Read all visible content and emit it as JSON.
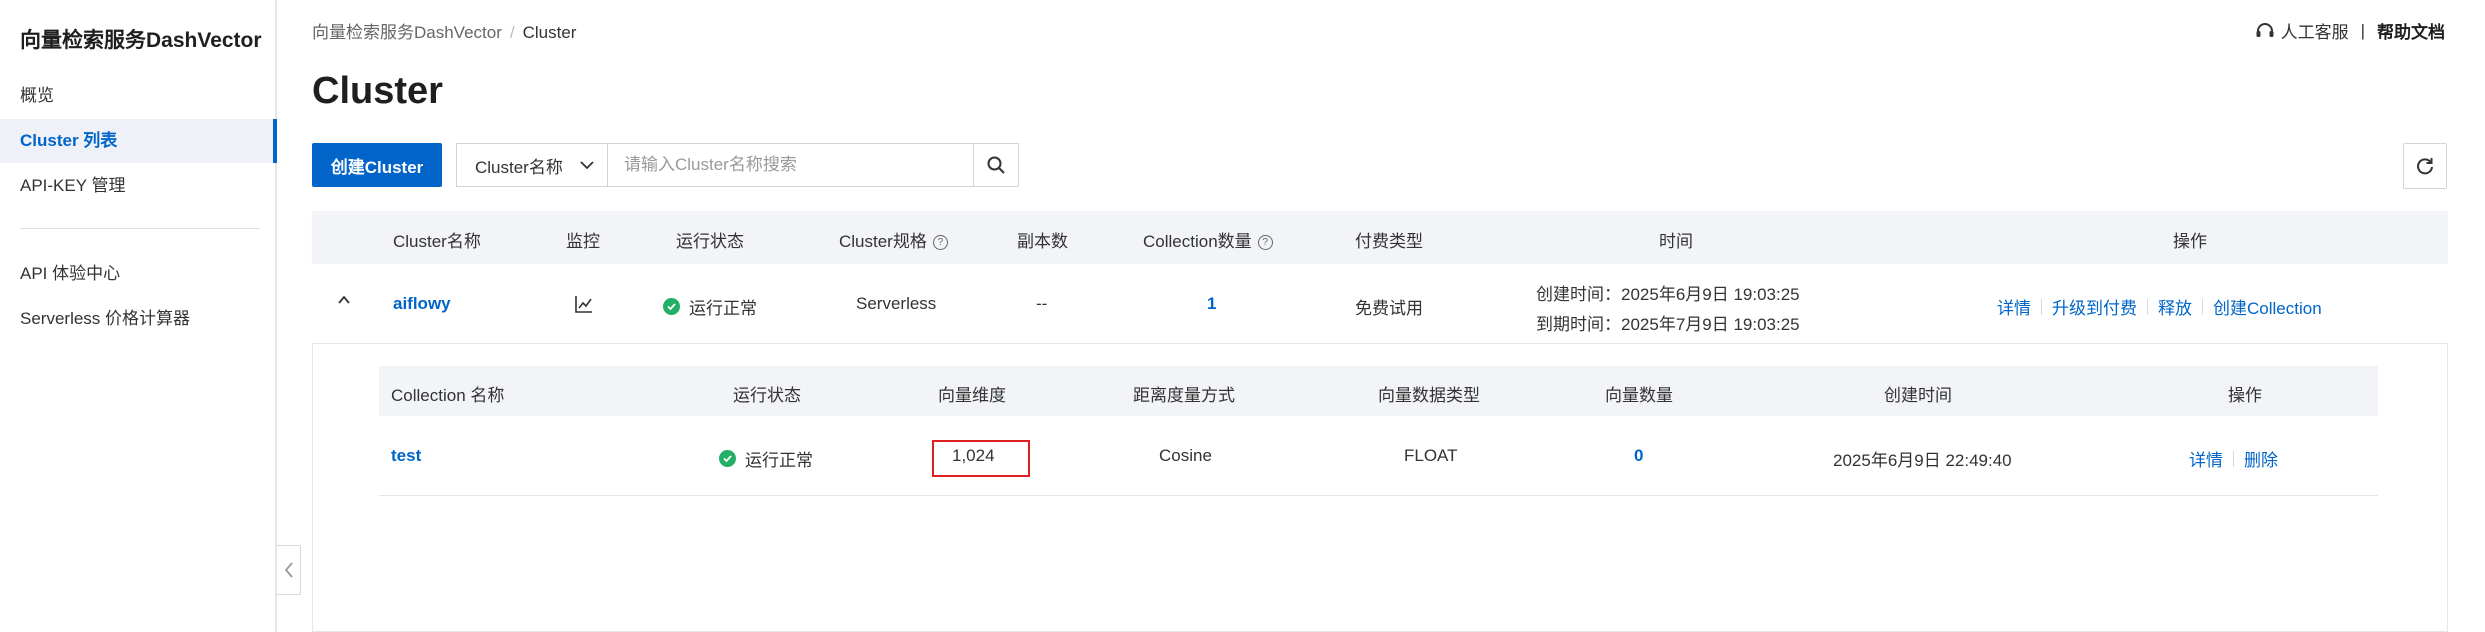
{
  "sidebar": {
    "brand": "向量检索服务DashVector",
    "items": [
      {
        "label": "概览"
      },
      {
        "label": "Cluster 列表"
      },
      {
        "label": "API-KEY 管理"
      },
      {
        "label": "API 体验中心"
      },
      {
        "label": "Serverless 价格计算器"
      }
    ]
  },
  "header": {
    "breadcrumb": [
      "向量检索服务DashVector",
      "Cluster"
    ],
    "breadcrumb_sep": "/",
    "support": "人工客服",
    "divider": "|",
    "help": "帮助文档"
  },
  "page": {
    "title": "Cluster"
  },
  "toolbar": {
    "create_label": "创建Cluster",
    "filter_field": "Cluster名称",
    "search_placeholder": "请输入Cluster名称搜索"
  },
  "cluster_table": {
    "columns": [
      "Cluster名称",
      "监控",
      "运行状态",
      "Cluster规格",
      "副本数",
      "Collection数量",
      "付费类型",
      "时间",
      "操作"
    ],
    "row": {
      "name": "aiflowy",
      "status": "运行正常",
      "spec": "Serverless",
      "replicas": "--",
      "collection_count": "1",
      "billing": "免费试用",
      "created": "创建时间：2025年6月9日 19:03:25",
      "expires": "到期时间：2025年7月9日 19:03:25",
      "actions": [
        "详情",
        "升级到付费",
        "释放",
        "创建Collection"
      ]
    }
  },
  "collection_table": {
    "columns": [
      "Collection 名称",
      "运行状态",
      "向量维度",
      "距离度量方式",
      "向量数据类型",
      "向量数量",
      "创建时间",
      "操作"
    ],
    "row": {
      "name": "test",
      "status": "运行正常",
      "dimension": "1,024",
      "metric": "Cosine",
      "dtype": "FLOAT",
      "count": "0",
      "created": "2025年6月9日 22:49:40",
      "actions": [
        "详情",
        "删除"
      ]
    }
  },
  "colors": {
    "accent": "#0064c8",
    "success": "#23b066",
    "highlight": "#e02020"
  }
}
